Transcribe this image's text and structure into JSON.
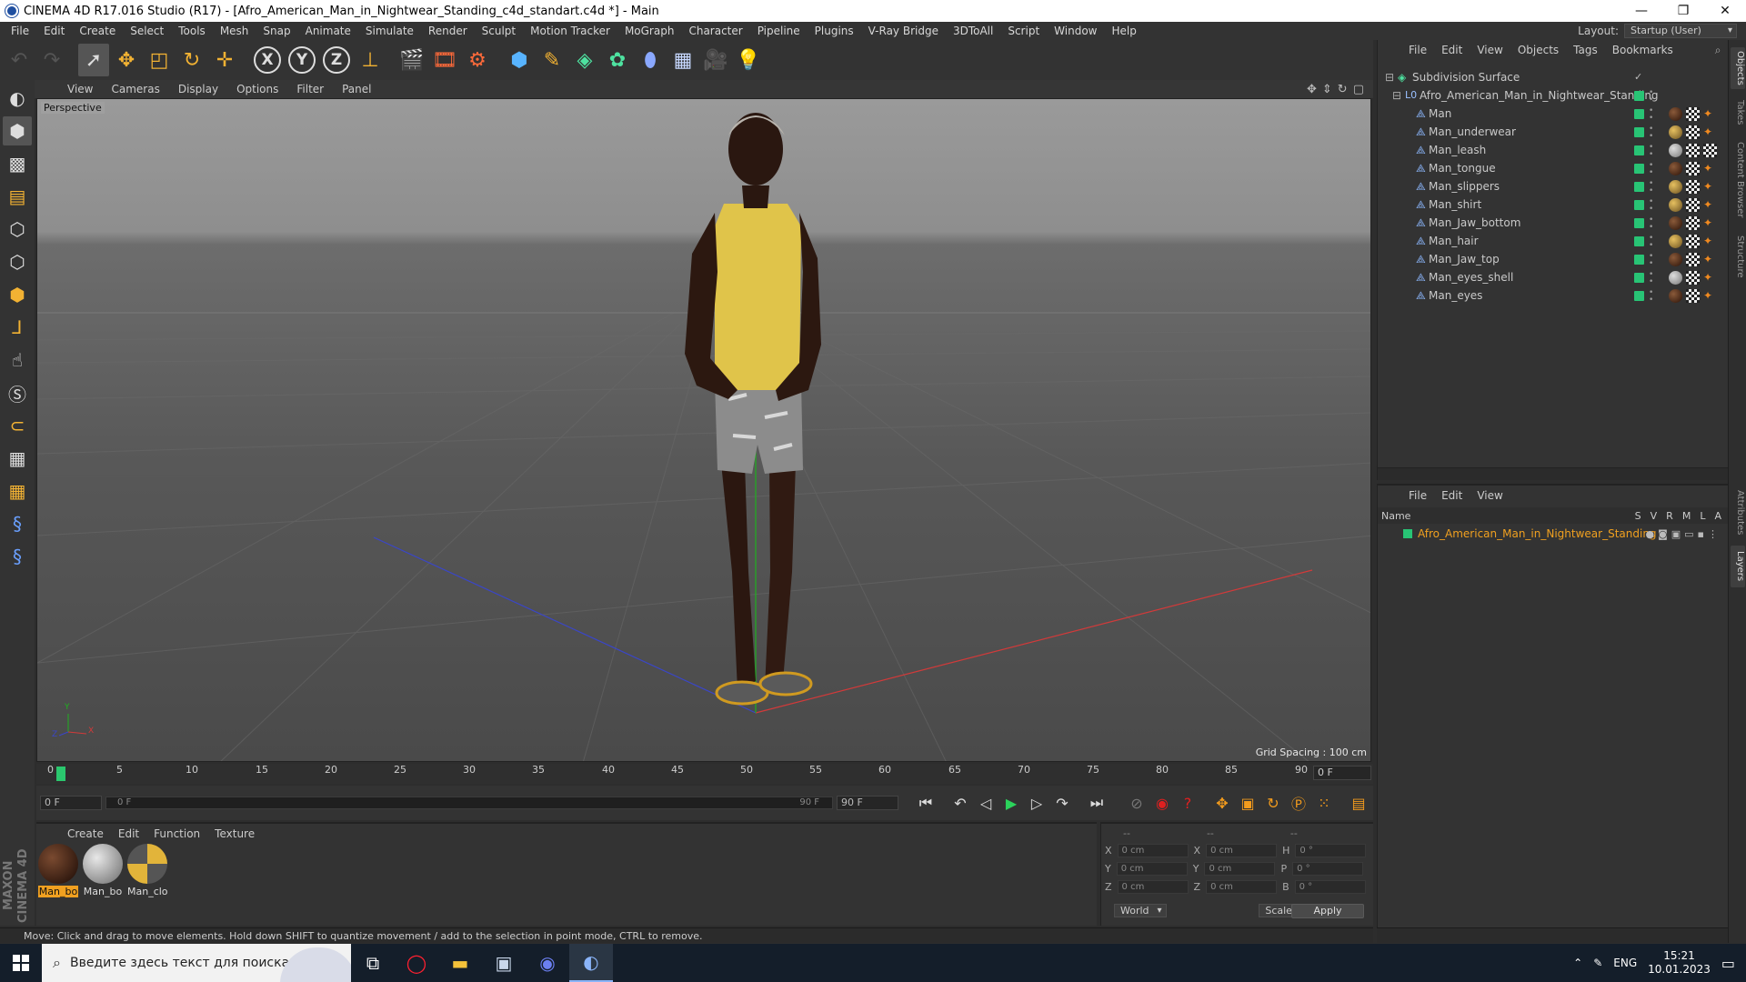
{
  "window": {
    "title": "CINEMA 4D R17.016 Studio (R17) - [Afro_American_Man_in_Nightwear_Standing_c4d_standart.c4d *] - Main",
    "controls": [
      "—",
      "❐",
      "✕"
    ]
  },
  "menubar": {
    "items": [
      "File",
      "Edit",
      "Create",
      "Select",
      "Tools",
      "Mesh",
      "Snap",
      "Animate",
      "Simulate",
      "Render",
      "Sculpt",
      "Motion Tracker",
      "MoGraph",
      "Character",
      "Pipeline",
      "Plugins",
      "V-Ray Bridge",
      "3DToAll",
      "Script",
      "Window",
      "Help"
    ],
    "layout_label": "Layout:",
    "layout_value": "Startup (User)"
  },
  "viewport": {
    "menu": [
      "View",
      "Cameras",
      "Display",
      "Options",
      "Filter",
      "Panel"
    ],
    "camera_label": "Perspective",
    "grid_spacing": "Grid Spacing : 100 cm",
    "axis_labels": {
      "y": "Y",
      "x": "X",
      "z": "Z"
    }
  },
  "object_manager": {
    "menu": [
      "File",
      "Edit",
      "View",
      "Objects",
      "Tags",
      "Bookmarks"
    ],
    "objects": [
      {
        "name": "Subdivision Surface",
        "indent": 0,
        "tags": []
      },
      {
        "name": "Afro_American_Man_in_Nightwear_Standing",
        "indent": 1,
        "tags": []
      },
      {
        "name": "Man",
        "indent": 2,
        "tags": [
          "brown",
          "chk",
          "org"
        ]
      },
      {
        "name": "Man_underwear",
        "indent": 2,
        "tags": [
          "yel",
          "chk",
          "org"
        ]
      },
      {
        "name": "Man_leash",
        "indent": 2,
        "tags": [
          "grey",
          "chk",
          "chk"
        ]
      },
      {
        "name": "Man_tongue",
        "indent": 2,
        "tags": [
          "brown",
          "chk",
          "org"
        ]
      },
      {
        "name": "Man_slippers",
        "indent": 2,
        "tags": [
          "yel",
          "chk",
          "org"
        ]
      },
      {
        "name": "Man_shirt",
        "indent": 2,
        "tags": [
          "yel",
          "chk",
          "org"
        ]
      },
      {
        "name": "Man_Jaw_bottom",
        "indent": 2,
        "tags": [
          "brown",
          "chk",
          "org"
        ]
      },
      {
        "name": "Man_hair",
        "indent": 2,
        "tags": [
          "yel",
          "chk",
          "org"
        ]
      },
      {
        "name": "Man_Jaw_top",
        "indent": 2,
        "tags": [
          "brown",
          "chk",
          "org"
        ]
      },
      {
        "name": "Man_eyes_shell",
        "indent": 2,
        "tags": [
          "grey",
          "chk",
          "org"
        ]
      },
      {
        "name": "Man_eyes",
        "indent": 2,
        "tags": [
          "brown",
          "chk",
          "org"
        ]
      }
    ]
  },
  "layer_manager": {
    "menu": [
      "File",
      "Edit",
      "View"
    ],
    "header_name": "Name",
    "columns": [
      "S",
      "V",
      "R",
      "M",
      "L",
      "A"
    ],
    "layers": [
      {
        "name": "Afro_American_Man_in_Nightwear_Standing",
        "color": "#28c475"
      }
    ]
  },
  "right_tabs": [
    "Objects",
    "Takes",
    "Content Browser",
    "Structure",
    "Attributes",
    "Layers"
  ],
  "timeline": {
    "ticks": [
      "0",
      "5",
      "10",
      "15",
      "20",
      "25",
      "30",
      "35",
      "40",
      "45",
      "50",
      "55",
      "60",
      "65",
      "70",
      "75",
      "80",
      "85",
      "90"
    ],
    "current_frame_right": "0 F",
    "start_field": "0 F",
    "range_start": "0 F",
    "range_end": "90 F",
    "end_field": "90 F"
  },
  "materials": {
    "menu": [
      "Create",
      "Edit",
      "Function",
      "Texture"
    ],
    "items": [
      {
        "label": "Man_bo",
        "selected": true,
        "type": "brown"
      },
      {
        "label": "Man_bo",
        "selected": false,
        "type": "grey"
      },
      {
        "label": "Man_clo",
        "selected": false,
        "type": "yellow"
      }
    ]
  },
  "coordinates": {
    "header": [
      "--",
      "--",
      "--"
    ],
    "rows": [
      {
        "a": "X",
        "av": "0 cm",
        "b": "X",
        "bv": "0 cm",
        "c": "H",
        "cv": "0 °"
      },
      {
        "a": "Y",
        "av": "0 cm",
        "b": "Y",
        "bv": "0 cm",
        "c": "P",
        "cv": "0 °"
      },
      {
        "a": "Z",
        "av": "0 cm",
        "b": "Z",
        "bv": "0 cm",
        "c": "B",
        "cv": "0 °"
      }
    ],
    "space": "World",
    "mode": "Scale",
    "apply": "Apply"
  },
  "status": "Move: Click and drag to move elements. Hold down SHIFT to quantize movement / add to the selection in point mode, CTRL to remove.",
  "branding": "MAXON CINEMA 4D",
  "taskbar": {
    "search_placeholder": "Введите здесь текст для поиска",
    "lang": "ENG",
    "time": "15:21",
    "date": "10.01.2023"
  },
  "colors": {
    "accent_green": "#28c475",
    "selection_orange": "#f0a020"
  }
}
